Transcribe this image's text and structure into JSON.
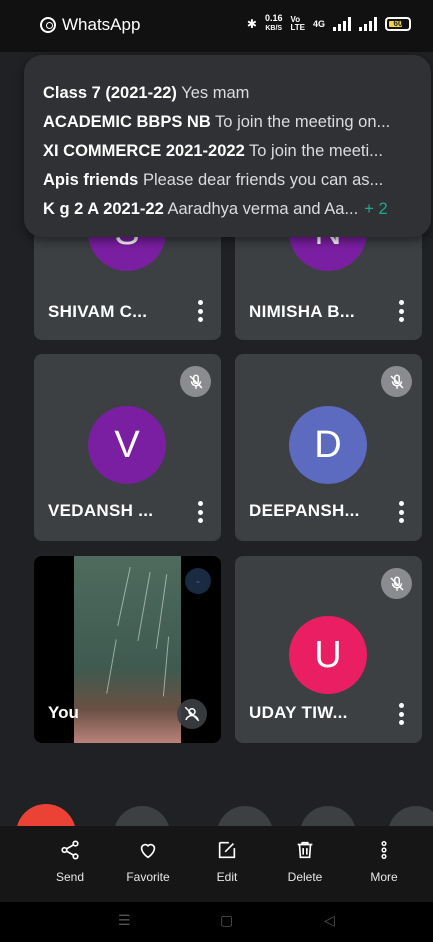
{
  "status_bar": {
    "app_name": "WhatsApp",
    "speed_value": "0.16",
    "speed_unit": "KB/S",
    "network": "4G",
    "battery": "60"
  },
  "notification": {
    "lines": [
      {
        "title": "Class 7 (2021-22)",
        "text": " Yes mam"
      },
      {
        "title": "ACADEMIC BBPS NB",
        "text": " To join the meeting on..."
      },
      {
        "title": "XI COMMERCE 2021-2022",
        "text": " To join the meeti..."
      },
      {
        "title": "Apis friends",
        "text": "  Please dear friends you can as..."
      },
      {
        "title": "K g 2 A 2021-22",
        "text": " Aaradhya verma and Aa...",
        "more": "+ 2"
      }
    ]
  },
  "participants": [
    {
      "initial": "S",
      "name": "SHIVAM C...",
      "color": "#7b1fa2",
      "muted": false
    },
    {
      "initial": "N",
      "name": "NIMISHA B...",
      "color": "#7b1fa2",
      "muted": false
    },
    {
      "initial": "V",
      "name": "VEDANSH ...",
      "color": "#7b1fa2",
      "muted": true
    },
    {
      "initial": "D",
      "name": "DEEPANSH...",
      "color": "#5c6bc0",
      "muted": true
    },
    {
      "initial": "U",
      "name": "UDAY TIW...",
      "color": "#e91e63",
      "muted": true
    }
  ],
  "self_tile": {
    "label": "You"
  },
  "action_bar": {
    "send": "Send",
    "favorite": "Favorite",
    "edit": "Edit",
    "delete": "Delete",
    "more": "More"
  }
}
